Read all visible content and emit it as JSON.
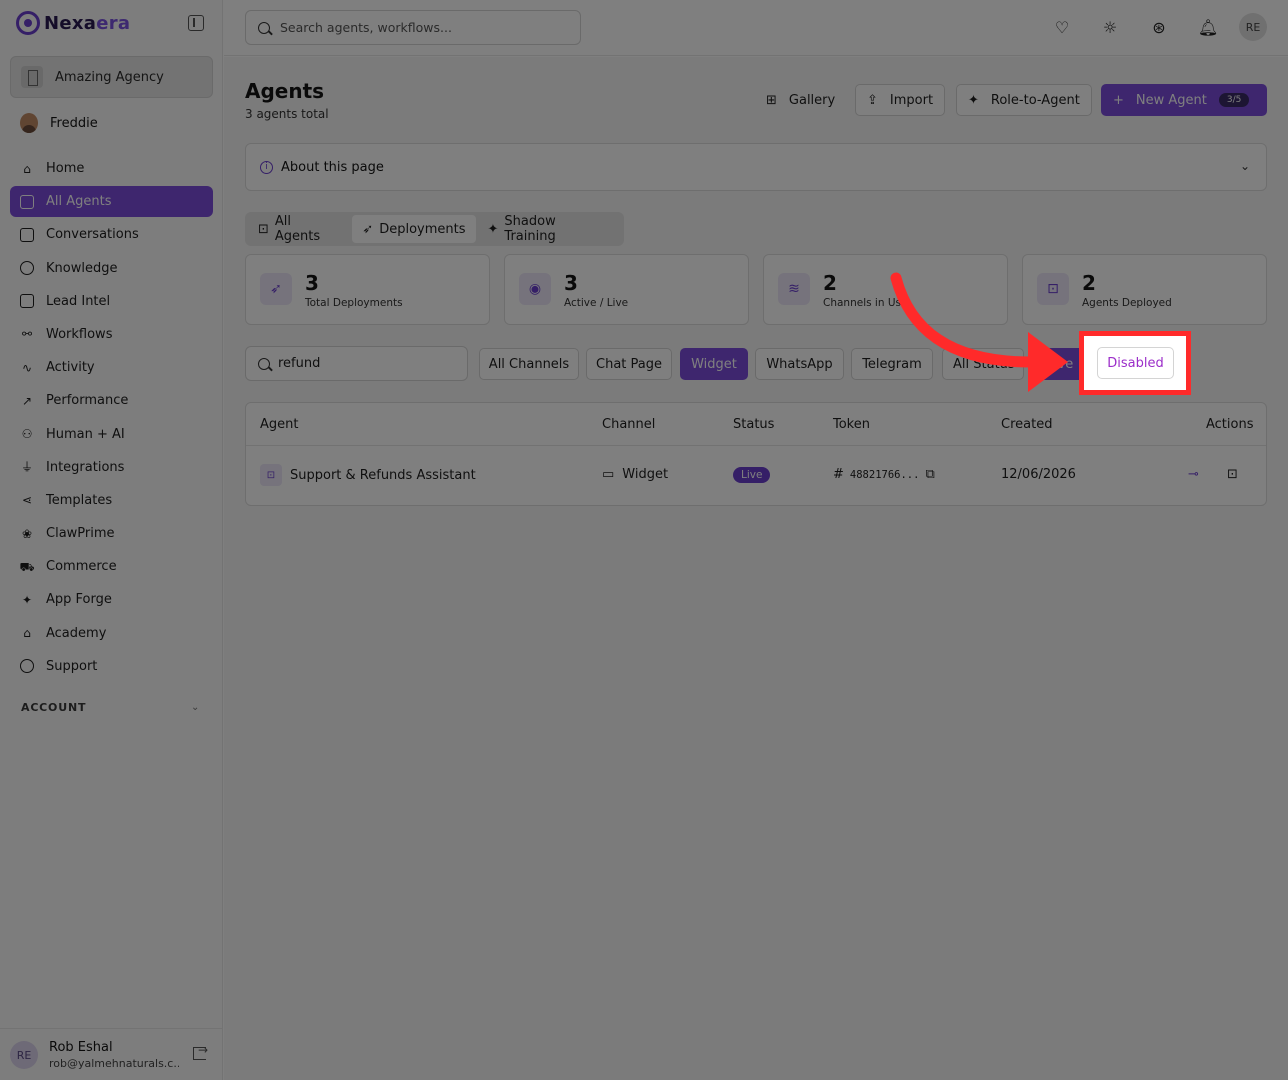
{
  "brand": {
    "name_main": "Nexa",
    "name_accent": "era"
  },
  "org": {
    "name": "Amazing Agency"
  },
  "current_user": {
    "name": "Freddie"
  },
  "nav": {
    "items": [
      {
        "label": "Home",
        "icon": "home-icon"
      },
      {
        "label": "All Agents",
        "icon": "bot-icon",
        "active": true
      },
      {
        "label": "Conversations",
        "icon": "chat-icon"
      },
      {
        "label": "Knowledge",
        "icon": "brain-icon"
      },
      {
        "label": "Lead Intel",
        "icon": "contact-icon"
      },
      {
        "label": "Workflows",
        "icon": "workflow-icon"
      },
      {
        "label": "Activity",
        "icon": "activity-icon"
      },
      {
        "label": "Performance",
        "icon": "trend-icon"
      },
      {
        "label": "Human + AI",
        "icon": "people-icon"
      },
      {
        "label": "Integrations",
        "icon": "plug-icon"
      },
      {
        "label": "Templates",
        "icon": "share-icon"
      },
      {
        "label": "ClawPrime",
        "icon": "paw-icon"
      },
      {
        "label": "Commerce",
        "icon": "cart-icon"
      },
      {
        "label": "App Forge",
        "icon": "sparkle-icon"
      },
      {
        "label": "Academy",
        "icon": "graduation-icon"
      },
      {
        "label": "Support",
        "icon": "lifebuoy-icon"
      }
    ],
    "section_label": "ACCOUNT"
  },
  "footer_user": {
    "initials": "RE",
    "name": "Rob Eshal",
    "email": "rob@yalmehnaturals.c..."
  },
  "topbar": {
    "search_placeholder": "Search agents, workflows...",
    "avatar_initials": "RE"
  },
  "page": {
    "title": "Agents",
    "subtitle": "3 agents total"
  },
  "header_buttons": {
    "gallery": "Gallery",
    "import": "Import",
    "role_to_agent": "Role-to-Agent",
    "new_agent": "New Agent",
    "quota": "3/5"
  },
  "about": {
    "label": "About this page"
  },
  "segments": [
    {
      "label": "All Agents",
      "icon": "bot-icon"
    },
    {
      "label": "Deployments",
      "icon": "rocket-icon",
      "active": true
    },
    {
      "label": "Shadow Training",
      "icon": "sparkle-icon"
    }
  ],
  "stats": [
    {
      "value": "3",
      "label": "Total Deployments",
      "icon": "rocket-icon"
    },
    {
      "value": "3",
      "label": "Active / Live",
      "icon": "broadcast-icon"
    },
    {
      "value": "2",
      "label": "Channels in Use",
      "icon": "layers-icon"
    },
    {
      "value": "2",
      "label": "Agents Deployed",
      "icon": "bot-icon"
    }
  ],
  "filters": {
    "search_value": "refund",
    "channels": [
      "All Channels",
      "Chat Page",
      "Widget",
      "WhatsApp",
      "Telegram"
    ],
    "active_channel": "Widget",
    "statuses": [
      "All Status",
      "Live",
      "Disabled"
    ],
    "highlighted_status": "Disabled"
  },
  "table": {
    "headers": [
      "Agent",
      "Channel",
      "Status",
      "Token",
      "Created",
      "Actions"
    ],
    "rows": [
      {
        "agent": "Support & Refunds Assistant",
        "channel": "Widget",
        "status": "Live",
        "token": "48821766...",
        "created": "12/06/2026"
      }
    ]
  },
  "colors": {
    "accent": "#7c4ddd",
    "annotation": "#ff2a2a"
  }
}
